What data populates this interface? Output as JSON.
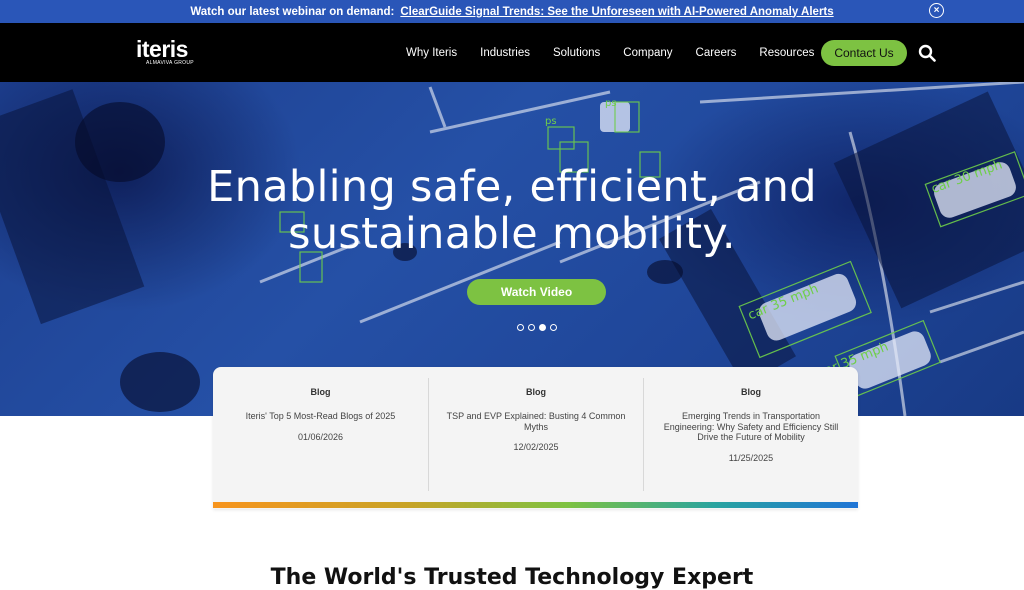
{
  "announcement": {
    "prefix": "Watch our latest webinar on demand:",
    "link": "ClearGuide Signal Trends: See the Unforeseen with AI-Powered Anomaly Alerts",
    "close_icon": "×"
  },
  "brand": {
    "name": "iteris",
    "sub": "ALMAVIVA GROUP"
  },
  "nav": {
    "items": [
      {
        "label": "Why Iteris"
      },
      {
        "label": "Industries"
      },
      {
        "label": "Solutions"
      },
      {
        "label": "Company"
      },
      {
        "label": "Careers"
      },
      {
        "label": "Resources"
      }
    ],
    "contact": "Contact Us"
  },
  "hero": {
    "line1": "Enabling safe, efficient, and",
    "line2": "sustainable mobility.",
    "button": "Watch Video",
    "overlay_labels": [
      "car 30 mph",
      "car 35 mph",
      "car 35 mph",
      "ps",
      "ps"
    ],
    "slides_total": 4,
    "slide_active": 3
  },
  "cards": [
    {
      "category": "Blog",
      "title": "Iteris' Top 5 Most-Read Blogs of 2025",
      "date": "01/06/2026"
    },
    {
      "category": "Blog",
      "title": "TSP and EVP Explained: Busting 4 Common Myths",
      "date": "12/02/2025"
    },
    {
      "category": "Blog",
      "title": "Emerging Trends in Transportation Engineering: Why Safety and Efficiency Still Drive the Future of Mobility",
      "date": "11/25/2025"
    }
  ],
  "section_title": "The World's Trusted Technology Expert",
  "colors": {
    "accent_green": "#7dc242",
    "announce_blue": "#2a56b8",
    "hero_blue": "#1f4699"
  }
}
